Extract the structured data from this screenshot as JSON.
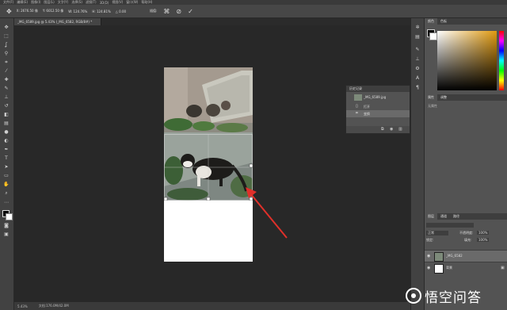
{
  "menubar": {
    "items": [
      "文件(F)",
      "编辑(E)",
      "图像(I)",
      "图层(L)",
      "文字(Y)",
      "选择(S)",
      "滤镜(T)",
      "3D(D)",
      "视图(V)",
      "窗口(W)",
      "帮助(H)"
    ]
  },
  "options": {
    "x": "X: 2676.50 像",
    "y": "Y: 6012.50 像",
    "w": "W: 124.76%",
    "h": "H: 124.81%",
    "angle": "△ 0.00",
    "interp": "插值:",
    "warp_icon": "warp-icon",
    "cancel_icon": "cancel-icon",
    "commit_icon": "commit-icon"
  },
  "document": {
    "tab_title": "_MG_6589.jpg @ 5.43% (_MG_6582, RGB/8#) *"
  },
  "status": {
    "zoom": "5.43%",
    "doc": "文档:176.0M/42.0M"
  },
  "history": {
    "title": "历史记录",
    "snapshot": "_MG_6589.jpg",
    "steps": [
      "打开",
      "变换"
    ]
  },
  "color_panel": {
    "tabs": [
      "颜色",
      "色板"
    ],
    "hue_color": "#e09a10"
  },
  "properties_panel": {
    "tabs": [
      "属性",
      "调整"
    ],
    "empty_text": "无属性"
  },
  "layers_panel": {
    "tabs": [
      "图层",
      "通道",
      "路径"
    ],
    "blend_mode": "正常",
    "opacity_label": "不透明度:",
    "opacity": "100%",
    "lock_label": "锁定:",
    "fill_label": "填充:",
    "fill": "100%",
    "layers": [
      {
        "name": "_MG_6582"
      },
      {
        "name": "背景"
      }
    ]
  },
  "watermark": {
    "text": "悟空问答"
  }
}
